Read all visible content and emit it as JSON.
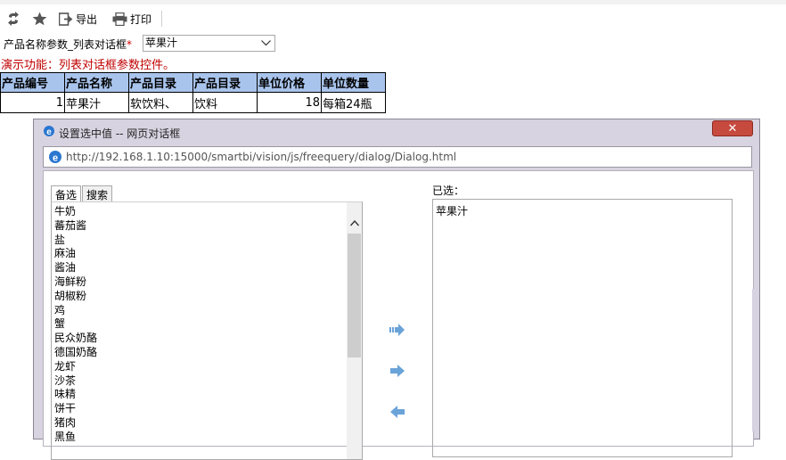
{
  "toolbar": {
    "refresh_icon": "refresh-icon",
    "favorite_icon": "star-icon",
    "export_label": "导出",
    "print_label": "打印"
  },
  "param": {
    "label": "产品名称参数_列表对话框",
    "required_mark": "*",
    "selected_value": "苹果汁"
  },
  "demo_note": "演示功能：列表对话框参数控件。",
  "table": {
    "headers": [
      "产品编号",
      "产品名称",
      "产品目录",
      "产品目录",
      "单位价格",
      "单位数量"
    ],
    "rows": [
      [
        "1",
        "苹果汁",
        "软饮料、",
        "饮料",
        "18",
        "每箱24瓶"
      ]
    ]
  },
  "dialog": {
    "title": "设置选中值 -- 网页对话框",
    "close_label": "✕",
    "url": "http://192.168.1.10:15000/smartbi/vision/js/freequery/dialog/Dialog.html",
    "tabs": [
      "备选",
      "搜索"
    ],
    "options": [
      "牛奶",
      "蕃茄酱",
      "盐",
      "麻油",
      "酱油",
      "海鲜粉",
      "胡椒粉",
      "鸡",
      "蟹",
      "民众奶酪",
      "德国奶酪",
      "龙虾",
      "沙茶",
      "味精",
      "饼干",
      "猪肉",
      "黑鱼"
    ],
    "selected_label": "已选：",
    "selected_items": [
      "苹果汁"
    ],
    "accent": "#6aa3d8"
  }
}
